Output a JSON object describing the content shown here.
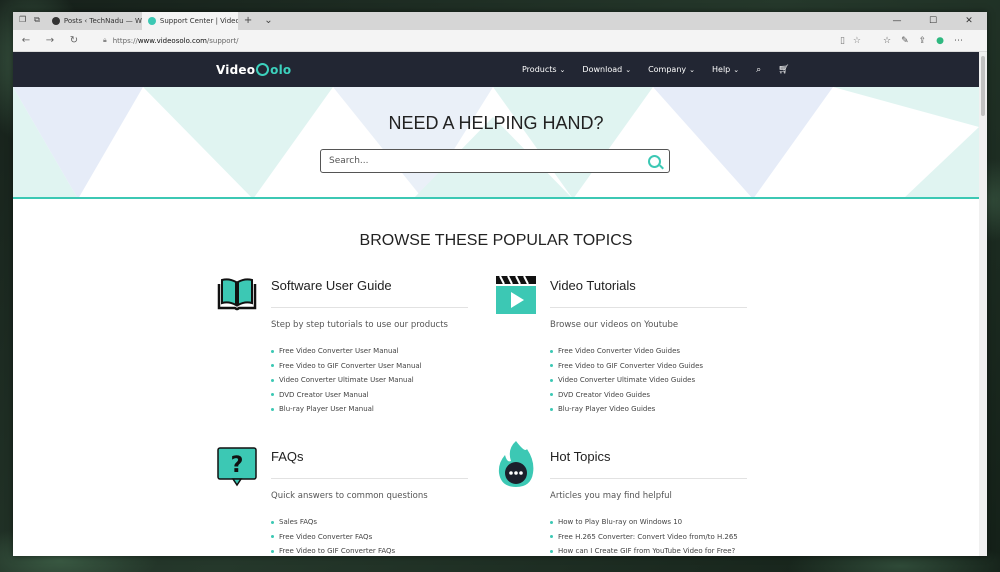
{
  "browser": {
    "tabs": [
      {
        "label": "Posts ‹ TechNadu — WordP",
        "active": false
      },
      {
        "label": "Support Center | VideoS",
        "active": true
      }
    ],
    "url_prefix": "https://",
    "url_domain": "www.videosolo.com",
    "url_path": "/support/"
  },
  "site": {
    "logo_video": "Video",
    "logo_solo": "olo",
    "nav": [
      {
        "label": "Products"
      },
      {
        "label": "Download"
      },
      {
        "label": "Company"
      },
      {
        "label": "Help"
      }
    ]
  },
  "hero": {
    "title": "NEED A HELPING HAND?",
    "search_placeholder": "Search..."
  },
  "browse_title": "BROWSE THESE POPULAR TOPICS",
  "topics": [
    {
      "title": "Software User Guide",
      "desc": "Step by step tutorials to use our products",
      "icon": "book-icon",
      "links": [
        "Free Video Converter User Manual",
        "Free Video to GIF Converter User Manual",
        "Video Converter Ultimate User Manual",
        "DVD Creator User Manual",
        "Blu-ray Player User Manual"
      ]
    },
    {
      "title": "Video Tutorials",
      "desc": "Browse our videos on Youtube",
      "icon": "video-clapper-icon",
      "links": [
        "Free Video Converter Video Guides",
        "Free Video to GIF Converter Video Guides",
        "Video Converter Ultimate Video Guides",
        "DVD Creator Video Guides",
        "Blu-ray Player Video Guides"
      ]
    },
    {
      "title": "FAQs",
      "desc": "Quick answers to common questions",
      "icon": "question-bubble-icon",
      "links": [
        "Sales FAQs",
        "Free Video Converter FAQs",
        "Free Video to GIF Converter FAQs"
      ]
    },
    {
      "title": "Hot Topics",
      "desc": "Articles you may find helpful",
      "icon": "flame-chat-icon",
      "links": [
        "How to Play Blu-ray on Windows 10",
        "Free H.265 Converter: Convert Video from/to H.265",
        "How can I Create GIF from YouTube Video for Free?"
      ]
    }
  ],
  "colors": {
    "accent": "#3cc8b4",
    "nav_bg": "#222633",
    "hero_tri_blue": "#e6ecf8",
    "hero_tri_teal": "#e0f4f1"
  }
}
